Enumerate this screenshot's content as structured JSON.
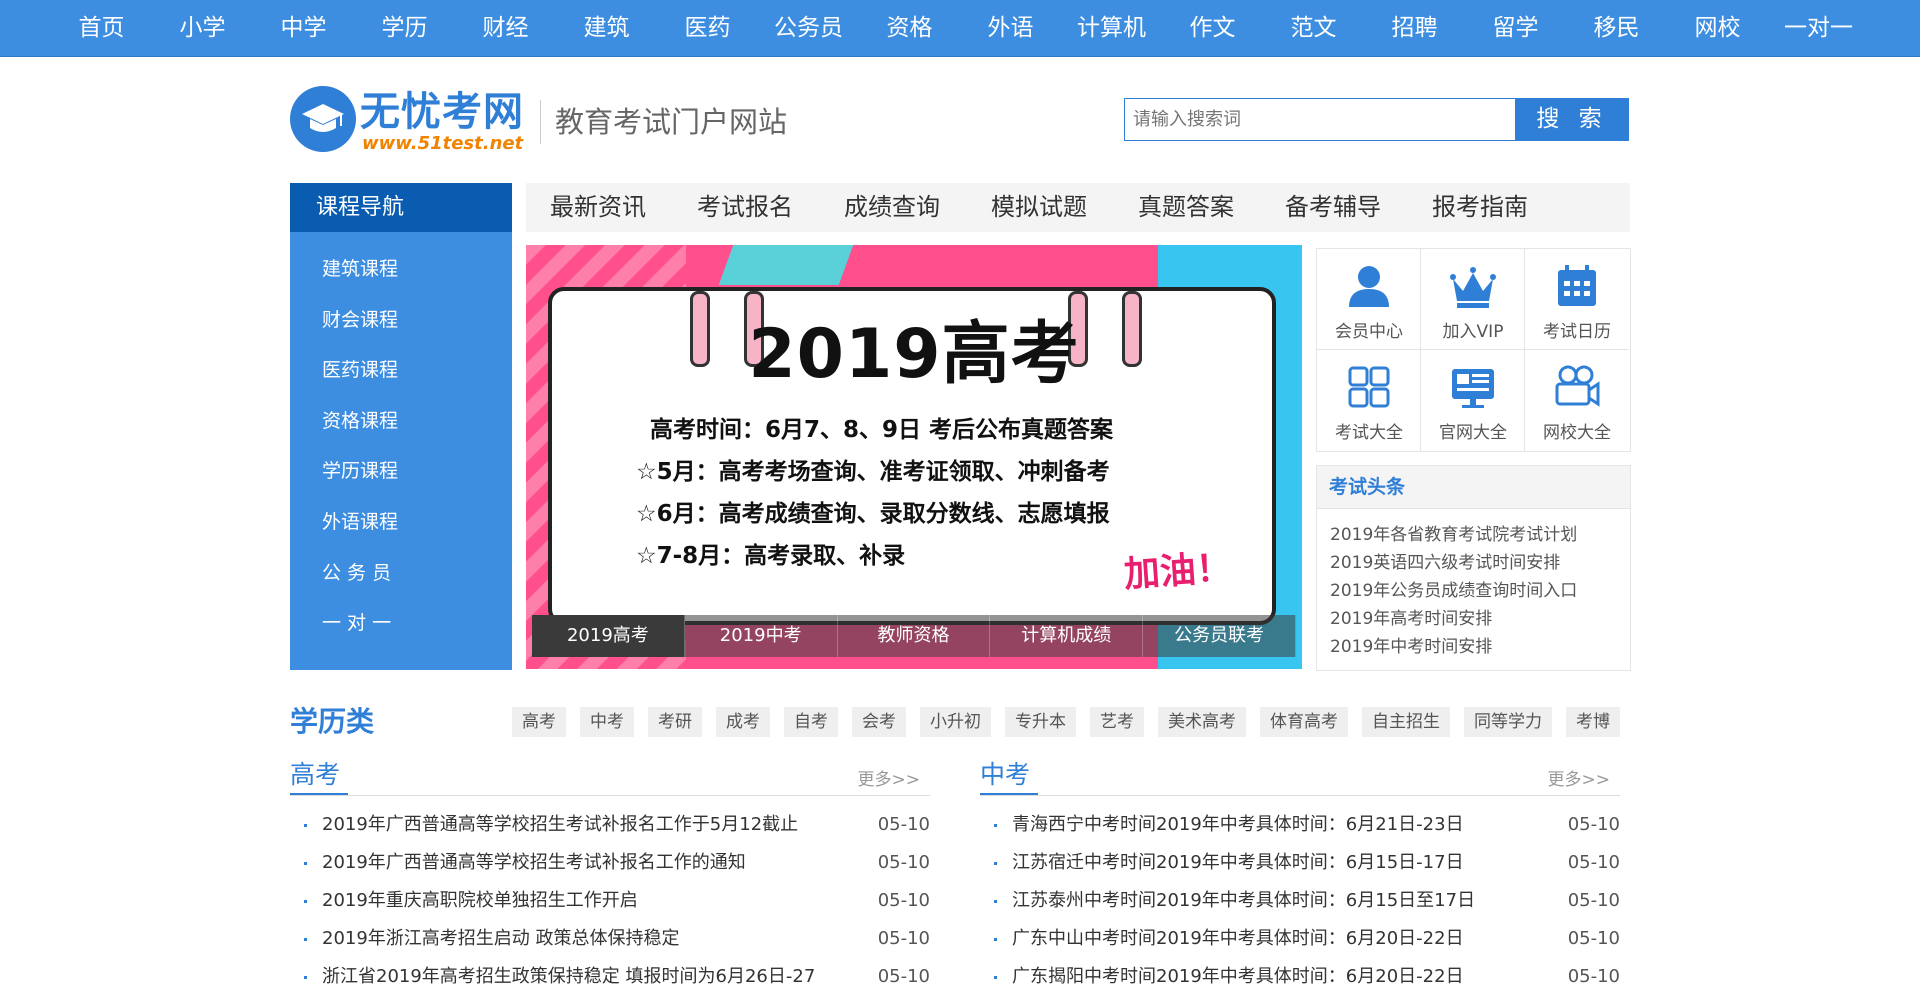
{
  "topnav": [
    "首页",
    "小学",
    "中学",
    "学历",
    "财经",
    "建筑",
    "医药",
    "公务员",
    "资格",
    "外语",
    "计算机",
    "作文",
    "范文",
    "招聘",
    "留学",
    "移民",
    "网校",
    "一对一"
  ],
  "logo": {
    "name": "无忧考网",
    "url": "www.51test.net"
  },
  "tagline": "教育考试门户网站",
  "search": {
    "placeholder": "请输入搜索词",
    "button": "搜 索"
  },
  "course": {
    "title": "课程导航",
    "items": [
      "建筑课程",
      "财会课程",
      "医药课程",
      "资格课程",
      "学历课程",
      "外语课程",
      "公 务 员",
      "一 对 一"
    ]
  },
  "subnav": [
    "最新资讯",
    "考试报名",
    "成绩查询",
    "模拟试题",
    "真题答案",
    "备考辅导",
    "报考指南"
  ],
  "banner": {
    "title": "2019高考",
    "lines": [
      "高考时间：6月7、8、9日  考后公布真题答案",
      "☆5月：高考考场查询、准考证领取、冲刺备考",
      "☆6月：高考成绩查询、录取分数线、志愿填报",
      "☆7-8月：高考录取、补录"
    ],
    "slogan": "加油！",
    "tabs": [
      "2019高考",
      "2019中考",
      "教师资格",
      "计算机成绩",
      "公务员联考"
    ]
  },
  "icons": [
    {
      "label": "会员中心",
      "icon": "user-icon"
    },
    {
      "label": "加入VIP",
      "icon": "crown-icon"
    },
    {
      "label": "考试日历",
      "icon": "calendar-icon"
    },
    {
      "label": "考试大全",
      "icon": "grid-icon"
    },
    {
      "label": "官网大全",
      "icon": "monitor-icon"
    },
    {
      "label": "网校大全",
      "icon": "video-camera-icon"
    }
  ],
  "news": {
    "title": "考试头条",
    "items": [
      "2019年各省教育考试院考试计划",
      "2019英语四六级考试时间安排",
      "2019年公务员成绩查询时间入口",
      "2019年高考时间安排",
      "2019年中考时间安排"
    ]
  },
  "education": {
    "title": "学历类",
    "tags": [
      "高考",
      "中考",
      "考研",
      "成考",
      "自考",
      "会考",
      "小升初",
      "专升本",
      "艺考",
      "美术高考",
      "体育高考",
      "自主招生",
      "同等学力",
      "考博"
    ]
  },
  "gaokao": {
    "title": "高考",
    "more": "更多>>",
    "items": [
      {
        "text": "2019年广西普通高等学校招生考试补报名工作于5月12截止",
        "date": "05-10"
      },
      {
        "text": "2019年广西普通高等学校招生考试补报名工作的通知",
        "date": "05-10"
      },
      {
        "text": "2019年重庆高职院校单独招生工作开启",
        "date": "05-10"
      },
      {
        "text": "2019年浙江高考招生启动 政策总体保持稳定",
        "date": "05-10"
      },
      {
        "text": "浙江省2019年高考招生政策保持稳定 填报时间为6月26日-27",
        "date": "05-10"
      }
    ]
  },
  "zhongkao": {
    "title": "中考",
    "more": "更多>>",
    "items": [
      {
        "text": "青海西宁中考时间2019年中考具体时间：6月21日-23日",
        "date": "05-10"
      },
      {
        "text": "江苏宿迁中考时间2019年中考具体时间：6月15日-17日",
        "date": "05-10"
      },
      {
        "text": "江苏泰州中考时间2019年中考具体时间：6月15日至17日",
        "date": "05-10"
      },
      {
        "text": "广东中山中考时间2019年中考具体时间：6月20日-22日",
        "date": "05-10"
      },
      {
        "text": "广东揭阳中考时间2019年中考具体时间：6月20日-22日",
        "date": "05-10"
      }
    ]
  },
  "colors": {
    "primary": "#3d8ee0",
    "dark": "#0a5cb0",
    "accent": "#f08300",
    "banner_pink": "#ff4f8c"
  }
}
